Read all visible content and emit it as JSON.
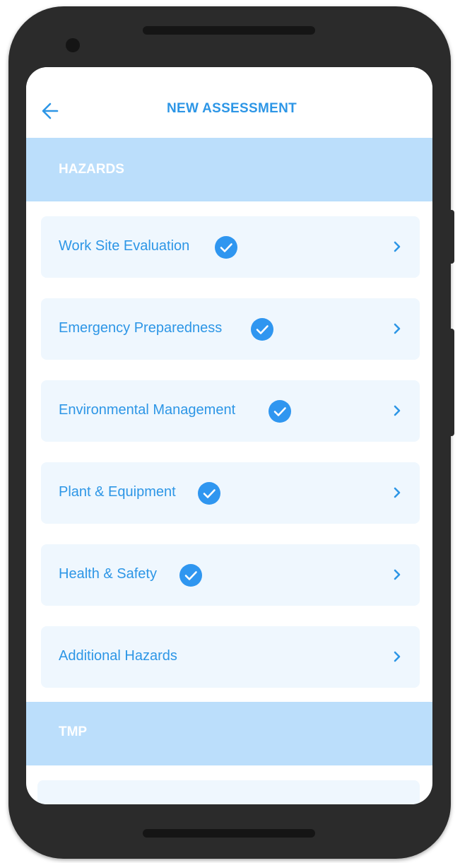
{
  "header": {
    "title": "NEW ASSESSMENT"
  },
  "sections": {
    "hazards": {
      "title": "HAZARDS",
      "items": [
        {
          "label": "Work Site Evaluation",
          "completed": true
        },
        {
          "label": "Emergency Preparedness",
          "completed": true
        },
        {
          "label": "Environmental Management",
          "completed": true
        },
        {
          "label": "Plant & Equipment",
          "completed": true
        },
        {
          "label": "Health & Safety",
          "completed": true
        },
        {
          "label": "Additional Hazards",
          "completed": false
        }
      ]
    },
    "tmp": {
      "title": "TMP"
    }
  },
  "icons": {
    "back": "arrow-left-icon",
    "completed": "check-circle-icon",
    "chevron": "chevron-right-icon"
  },
  "colors": {
    "accent": "#2d96e6",
    "check": "#2f96f0",
    "section_bg": "#bbdefb",
    "item_bg": "#eff7fe",
    "phone_frame": "#2b2b2b"
  }
}
